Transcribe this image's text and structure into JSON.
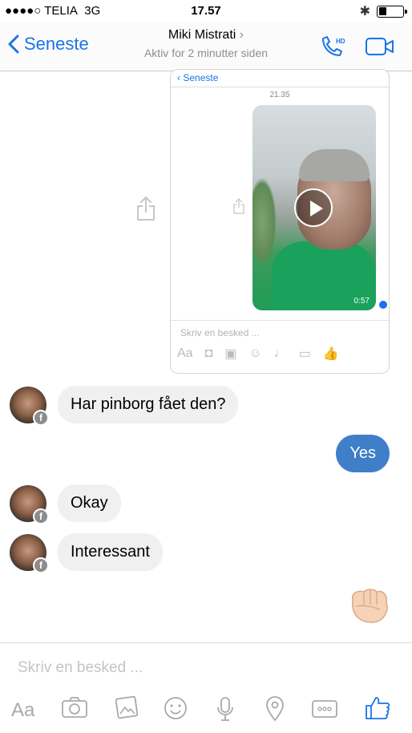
{
  "status": {
    "carrier": "●●●●○ TELIA",
    "network": "3G",
    "time": "17.57",
    "battery_level": 0.35
  },
  "nav": {
    "back_label": "Seneste",
    "contact_name": "Miki Mistrati",
    "subtitle": "Aktiv for 2 minutter siden",
    "accent": "#1a74e8"
  },
  "screenshot": {
    "back_label": "Seneste",
    "time": "21.35",
    "video_duration": "0:57",
    "placeholder": "Skriv en besked ...",
    "tools_aa": "Aa"
  },
  "messages": [
    {
      "from": "them",
      "text": "Har pinborg fået den?"
    },
    {
      "from": "me",
      "text": "Yes"
    },
    {
      "from": "them",
      "text": "Okay"
    },
    {
      "from": "them",
      "text": "Interessant"
    }
  ],
  "composer": {
    "placeholder": "Skriv en besked ...",
    "aa": "Aa"
  },
  "icons": [
    "phone-hd-icon",
    "video-call-icon",
    "share-icon",
    "camera-icon",
    "gallery-icon",
    "emoji-icon",
    "mic-icon",
    "location-icon",
    "more-icon",
    "like-icon"
  ]
}
